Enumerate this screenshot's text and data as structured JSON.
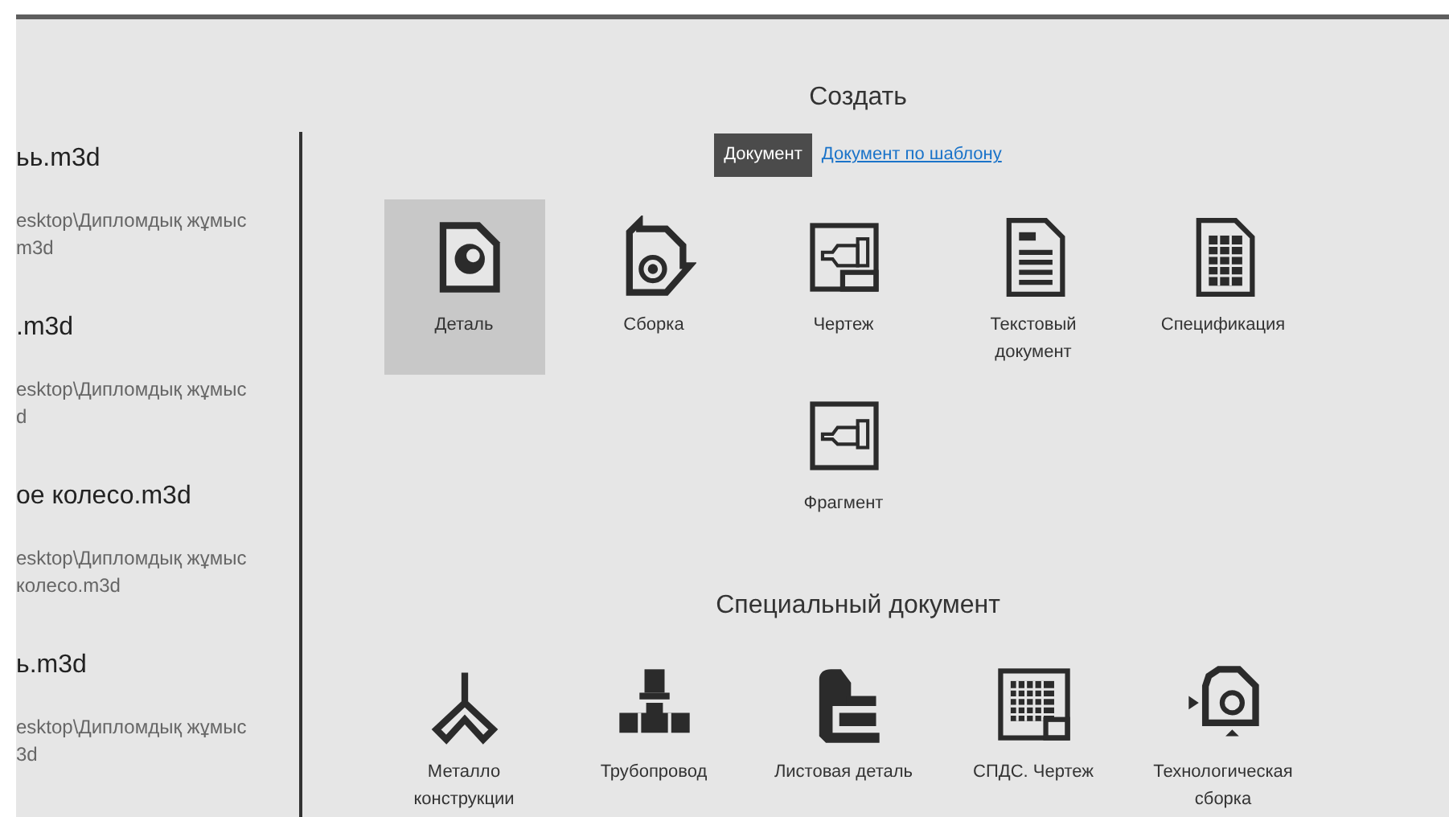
{
  "recent_files": [
    {
      "name": "ьь.m3d",
      "path": [
        "esktop\\Дипломдық жұмыс",
        "m3d"
      ]
    },
    {
      "name": ".m3d",
      "path": [
        "esktop\\Дипломдық жұмыс",
        "d"
      ]
    },
    {
      "name": "ое колесо.m3d",
      "path": [
        "esktop\\Дипломдық жұмыс",
        "колесо.m3d"
      ]
    },
    {
      "name": "ь.m3d",
      "path": [
        "esktop\\Дипломдық жұмыс",
        "3d"
      ]
    }
  ],
  "create": {
    "title": "Создать",
    "tabs": [
      {
        "label": "Документ",
        "selected": true
      },
      {
        "label": "Документ по шаблону",
        "selected": false
      }
    ],
    "items": [
      {
        "label": "Деталь",
        "kind": "part",
        "selected": true
      },
      {
        "label": "Сборка",
        "kind": "assembly",
        "selected": false
      },
      {
        "label": "Чертеж",
        "kind": "drawing",
        "selected": false
      },
      {
        "label": "Текстовый документ",
        "kind": "text",
        "selected": false
      },
      {
        "label": "Спецификация",
        "kind": "spec",
        "selected": false
      },
      {
        "label": "Фрагмент",
        "kind": "fragment",
        "selected": false
      }
    ]
  },
  "special": {
    "title": "Специальный документ",
    "items": [
      {
        "label": "Металло конструкции",
        "kind": "metal",
        "selected": false
      },
      {
        "label": "Трубопровод",
        "kind": "pipe",
        "selected": false
      },
      {
        "label": "Листовая деталь",
        "kind": "sheet",
        "selected": false
      },
      {
        "label": "СПДС. Чертеж",
        "kind": "building",
        "selected": false
      },
      {
        "label": "Технологическая сборка",
        "kind": "tech",
        "selected": false
      }
    ]
  }
}
